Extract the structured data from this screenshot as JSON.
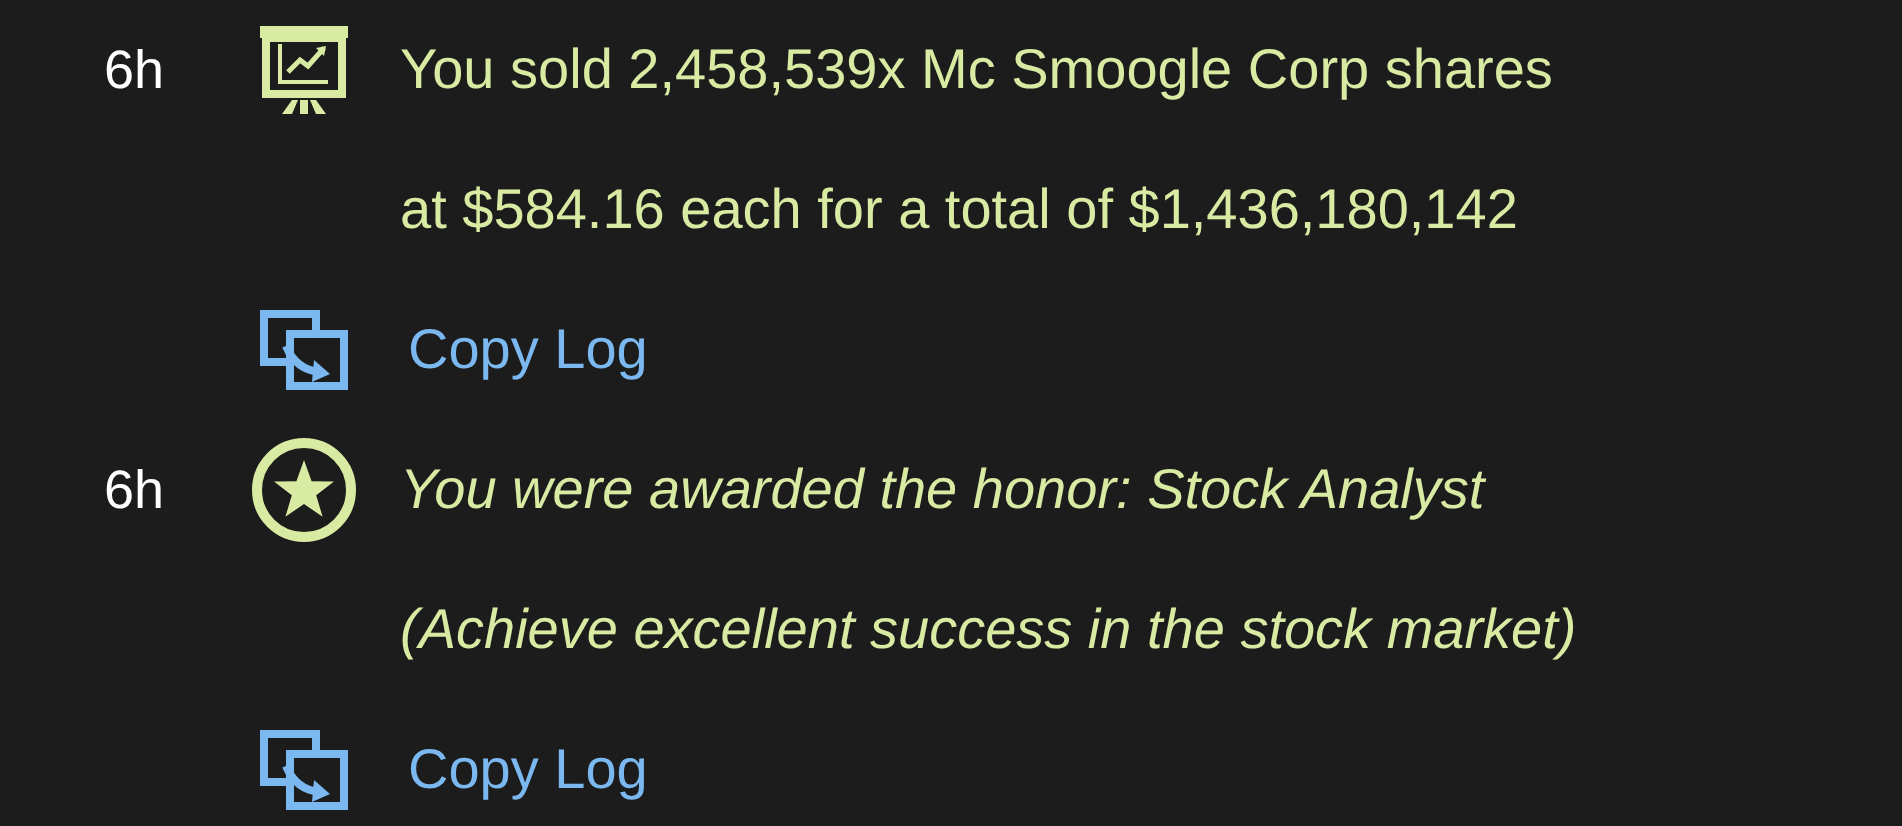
{
  "entries": [
    {
      "time": "6h",
      "kind": "trade",
      "lines": [
        "You sold 2,458,539x Mc Smoogle Corp shares",
        "at $584.16 each for a total of $1,436,180,142"
      ],
      "action": "Copy Log"
    },
    {
      "time": "6h",
      "kind": "honor",
      "lines": [
        "You were awarded the honor: Stock Analyst",
        "(Achieve excellent success in the stock market)"
      ],
      "action": "Copy Log"
    }
  ]
}
